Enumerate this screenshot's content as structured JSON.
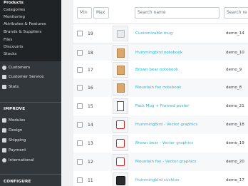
{
  "sidebar": {
    "catalog_submenu": [
      {
        "label": "Products",
        "active": true
      },
      {
        "label": "Categories"
      },
      {
        "label": "Monitoring"
      },
      {
        "label": "Attributes & Features"
      },
      {
        "label": "Brands & Suppliers"
      },
      {
        "label": "Files"
      },
      {
        "label": "Discounts"
      },
      {
        "label": "Stocks"
      }
    ],
    "customers": {
      "label": "Customers",
      "icon": "account-circle-icon"
    },
    "customer_service": {
      "label": "Customer Service",
      "icon": "chat-icon"
    },
    "stats": {
      "label": "Stats",
      "icon": "bar-chart-icon"
    },
    "improve_header": "IMPROVE",
    "modules": {
      "label": "Modules",
      "icon": "puzzle-icon"
    },
    "design": {
      "label": "Design",
      "icon": "desktop-icon"
    },
    "shipping": {
      "label": "Shipping",
      "icon": "truck-icon"
    },
    "payment": {
      "label": "Payment",
      "icon": "credit-card-icon"
    },
    "international": {
      "label": "International",
      "icon": "globe-icon"
    },
    "configure_header": "CONFIGURE"
  },
  "filters": {
    "min_placeholder": "Min",
    "max_placeholder": "Max",
    "name_placeholder": "Search name",
    "reference_placeholder": "Search re"
  },
  "products": [
    {
      "id": "19",
      "name": "Customizable mug",
      "reference": "demo_14",
      "thumb": "mug"
    },
    {
      "id": "18",
      "name": "Hummingbird notebook",
      "reference": "demo_10",
      "thumb": "notebook"
    },
    {
      "id": "17",
      "name": "Brown bear notebook",
      "reference": "demo_9",
      "thumb": "notebook"
    },
    {
      "id": "16",
      "name": "Mountain fox notebook",
      "reference": "demo_8",
      "thumb": "notebook"
    },
    {
      "id": "15",
      "name": "Pack Mug + Framed poster",
      "reference": "demo_21",
      "thumb": "poster"
    },
    {
      "id": "14",
      "name": "Hummingbird - Vector graphics",
      "reference": "demo_18",
      "thumb": "vector"
    },
    {
      "id": "13",
      "name": "Brown bear - Vector graphics",
      "reference": "demo_19",
      "thumb": "vector"
    },
    {
      "id": "12",
      "name": "Mountain fox - Vector graphics",
      "reference": "demo_20",
      "thumb": "vector"
    },
    {
      "id": "11",
      "name": "Hummingbird cushion",
      "reference": "demo_17",
      "thumb": "cushion"
    }
  ]
}
